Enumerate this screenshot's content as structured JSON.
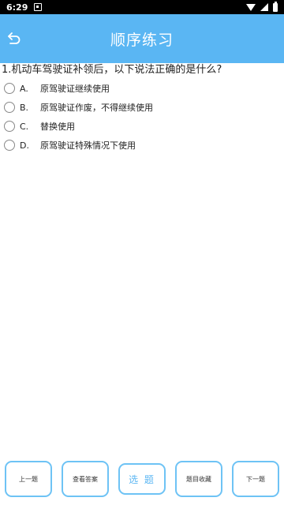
{
  "status_bar": {
    "time": "6:29"
  },
  "app_bar": {
    "title": "顺序练习"
  },
  "question": {
    "text": "1.机动车驾驶证补领后，以下说法正确的是什么?",
    "options": [
      {
        "letter": "A.",
        "text": "原驾驶证继续使用"
      },
      {
        "letter": "B.",
        "text": "原驾驶证作废，不得继续使用"
      },
      {
        "letter": "C.",
        "text": "替换使用"
      },
      {
        "letter": "D.",
        "text": "原驾驶证特殊情况下使用"
      }
    ]
  },
  "bottom_buttons": {
    "prev": "上一题",
    "answer": "查看答案",
    "select": "选 题",
    "favorite": "题目收藏",
    "next": "下一题"
  },
  "colors": {
    "accent": "#5ab6f3",
    "button_border": "#6ec3f5"
  }
}
